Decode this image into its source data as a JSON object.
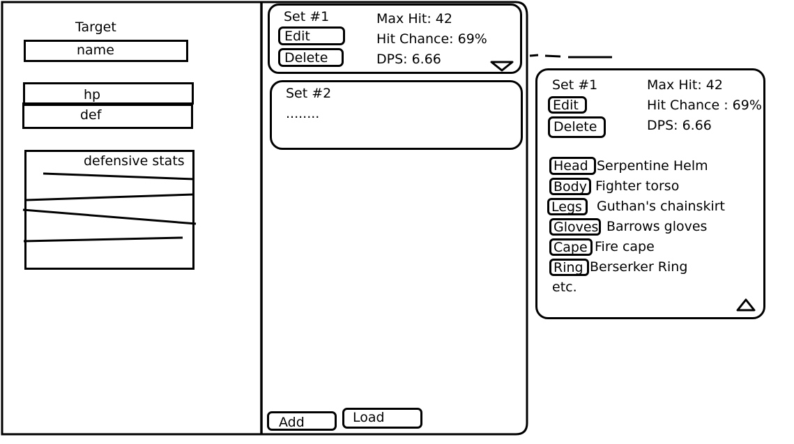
{
  "target_panel": {
    "title": "Target",
    "name_label": "name",
    "hp_label": "hp",
    "def_label": "def",
    "defensive_stats_label": "defensive stats"
  },
  "sets": [
    {
      "name": "Set #1",
      "edit_label": "Edit",
      "delete_label": "Delete",
      "max_hit": "Max Hit: 42",
      "hit_chance": "Hit Chance: 69%",
      "dps": "DPS: 6.66"
    },
    {
      "name": "Set #2",
      "placeholder": "........"
    }
  ],
  "bottom_buttons": {
    "add_label": "Add",
    "load_label": "Load"
  },
  "expanded_set": {
    "name": "Set #1",
    "edit_label": "Edit",
    "delete_label": "Delete",
    "max_hit": "Max Hit: 42",
    "hit_chance": "Hit Chance : 69%",
    "dps": "DPS: 6.66",
    "slots": [
      {
        "slot": "Head",
        "item": "Serpentine Helm"
      },
      {
        "slot": "Body",
        "item": "Fighter torso"
      },
      {
        "slot": "Legs",
        "item": "Guthan's chainskirt"
      },
      {
        "slot": "Gloves",
        "item": "Barrows gloves"
      },
      {
        "slot": "Cape",
        "item": "Fire cape"
      },
      {
        "slot": "Ring",
        "item": "Berserker Ring"
      }
    ],
    "more": "etc."
  },
  "icons": {
    "collapsed_toggle": "chevron-down-icon",
    "expanded_toggle": "chevron-up-icon"
  }
}
